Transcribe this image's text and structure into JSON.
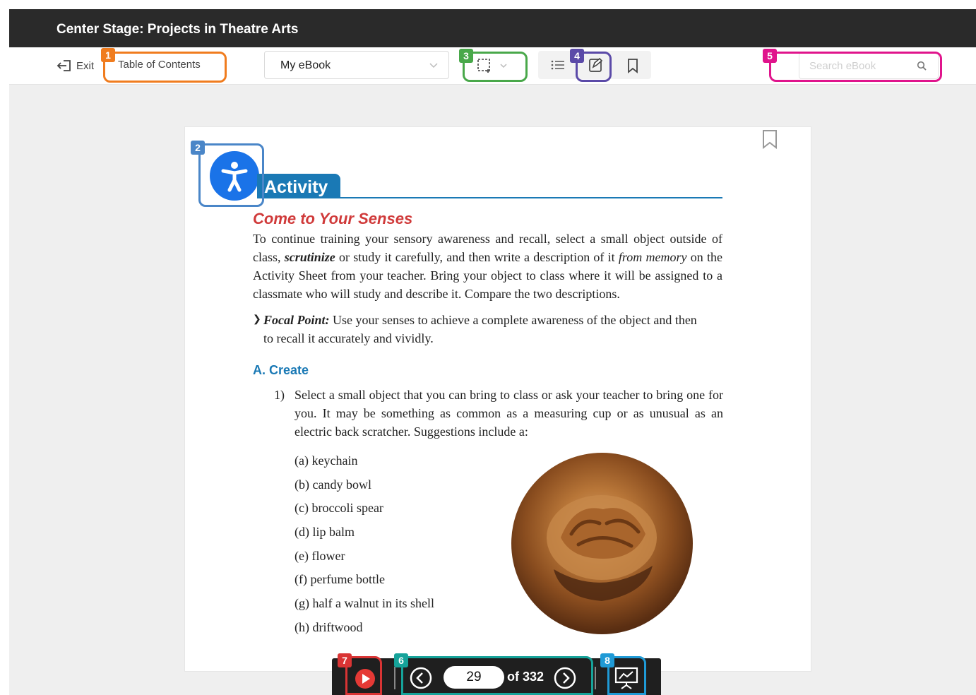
{
  "window": {
    "title": "Center Stage: Projects in Theatre Arts"
  },
  "toolbar": {
    "exit_label": "Exit",
    "toc_label": "Table of Contents",
    "book_select_value": "My eBook",
    "search_placeholder": "Search eBook"
  },
  "icons": {
    "exit": "exit-icon",
    "select_region": "region-select-icon",
    "list": "list-icon",
    "notes": "notes-icon",
    "bookmark": "bookmark-icon",
    "search": "search-icon",
    "accessibility": "accessibility-icon",
    "play": "play-icon",
    "prev": "prev-page-icon",
    "next": "next-page-icon",
    "presentation": "presentation-icon"
  },
  "annotations": [
    {
      "label": "1",
      "color": "#f07c1e"
    },
    {
      "label": "2",
      "color": "#4a86c8"
    },
    {
      "label": "3",
      "color": "#49a84a"
    },
    {
      "label": "4",
      "color": "#5b4aa8"
    },
    {
      "label": "5",
      "color": "#e0148c"
    },
    {
      "label": "6",
      "color": "#16a39a"
    },
    {
      "label": "7",
      "color": "#d93434"
    },
    {
      "label": "8",
      "color": "#1f9ad6"
    }
  ],
  "content": {
    "section_tab": "Activity",
    "subheading": "Come to Your Senses",
    "intro_1": "To continue training your sensory awareness and recall, select a small object outside of class, ",
    "intro_em": "scrutinize",
    "intro_2": " or study it carefully, and then write a description of it ",
    "intro_em2": "from memory",
    "intro_3": " on the Activity Sheet from your teacher. Bring your object to class where it will be assigned to a classmate who will study and describe it. Compare the two descriptions.",
    "focal_label": "Focal Point:",
    "focal_text": " Use your senses to achieve a complete awareness of the object and then to recall it accurately and vividly.",
    "section_a": "A.  Create",
    "item1_num": "1)",
    "item1_text": "Select a small object that you can bring to class or ask your teacher to bring one for you. It may be something as common as a measuring cup or as unusual as an electric back scratcher. Suggestions include a:",
    "suggestions": [
      "(a)  keychain",
      "(b)  candy bowl",
      "(c)  broccoli spear",
      "(d)  lip balm",
      "(e)  flower",
      "(f)  perfume bottle",
      "(g)  half a walnut in its shell",
      "(h)  driftwood"
    ]
  },
  "pager": {
    "current_page": "29",
    "total_label": "of 332"
  },
  "colors": {
    "accent_blue": "#1a79b5",
    "subheading_red": "#d03a3a",
    "titlebar": "#2a2a2a"
  }
}
